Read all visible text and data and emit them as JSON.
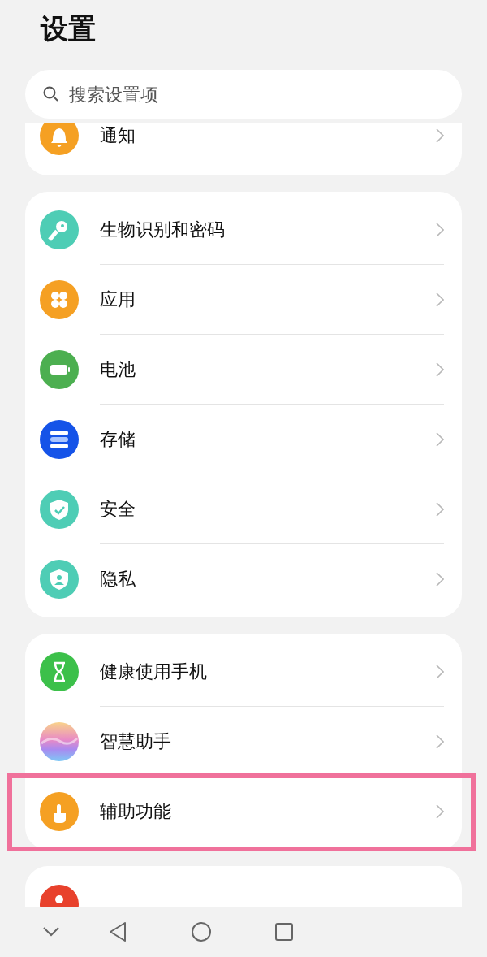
{
  "title": "设置",
  "search": {
    "placeholder": "搜索设置项"
  },
  "groups": [
    {
      "clipped_top": true,
      "items": [
        {
          "kind": "bell",
          "label": "通知",
          "highlighted": false
        }
      ]
    },
    {
      "clipped_top": false,
      "items": [
        {
          "kind": "key",
          "label": "生物识别和密码",
          "highlighted": false
        },
        {
          "kind": "apps",
          "label": "应用",
          "highlighted": false
        },
        {
          "kind": "battery",
          "label": "电池",
          "highlighted": false
        },
        {
          "kind": "storage",
          "label": "存储",
          "highlighted": false
        },
        {
          "kind": "shield",
          "label": "安全",
          "highlighted": false
        },
        {
          "kind": "privacy",
          "label": "隐私",
          "highlighted": false
        }
      ]
    },
    {
      "clipped_top": false,
      "items": [
        {
          "kind": "hourglass",
          "label": "健康使用手机",
          "highlighted": false
        },
        {
          "kind": "assistant",
          "label": "智慧助手",
          "highlighted": false
        },
        {
          "kind": "touch",
          "label": "辅助功能",
          "highlighted": true
        }
      ]
    },
    {
      "clipped_top": false,
      "items": [
        {
          "kind": "user"
        }
      ]
    }
  ],
  "nav": [
    {
      "kind": "down"
    },
    {
      "kind": "back"
    },
    {
      "kind": "home"
    },
    {
      "kind": "recent"
    }
  ]
}
